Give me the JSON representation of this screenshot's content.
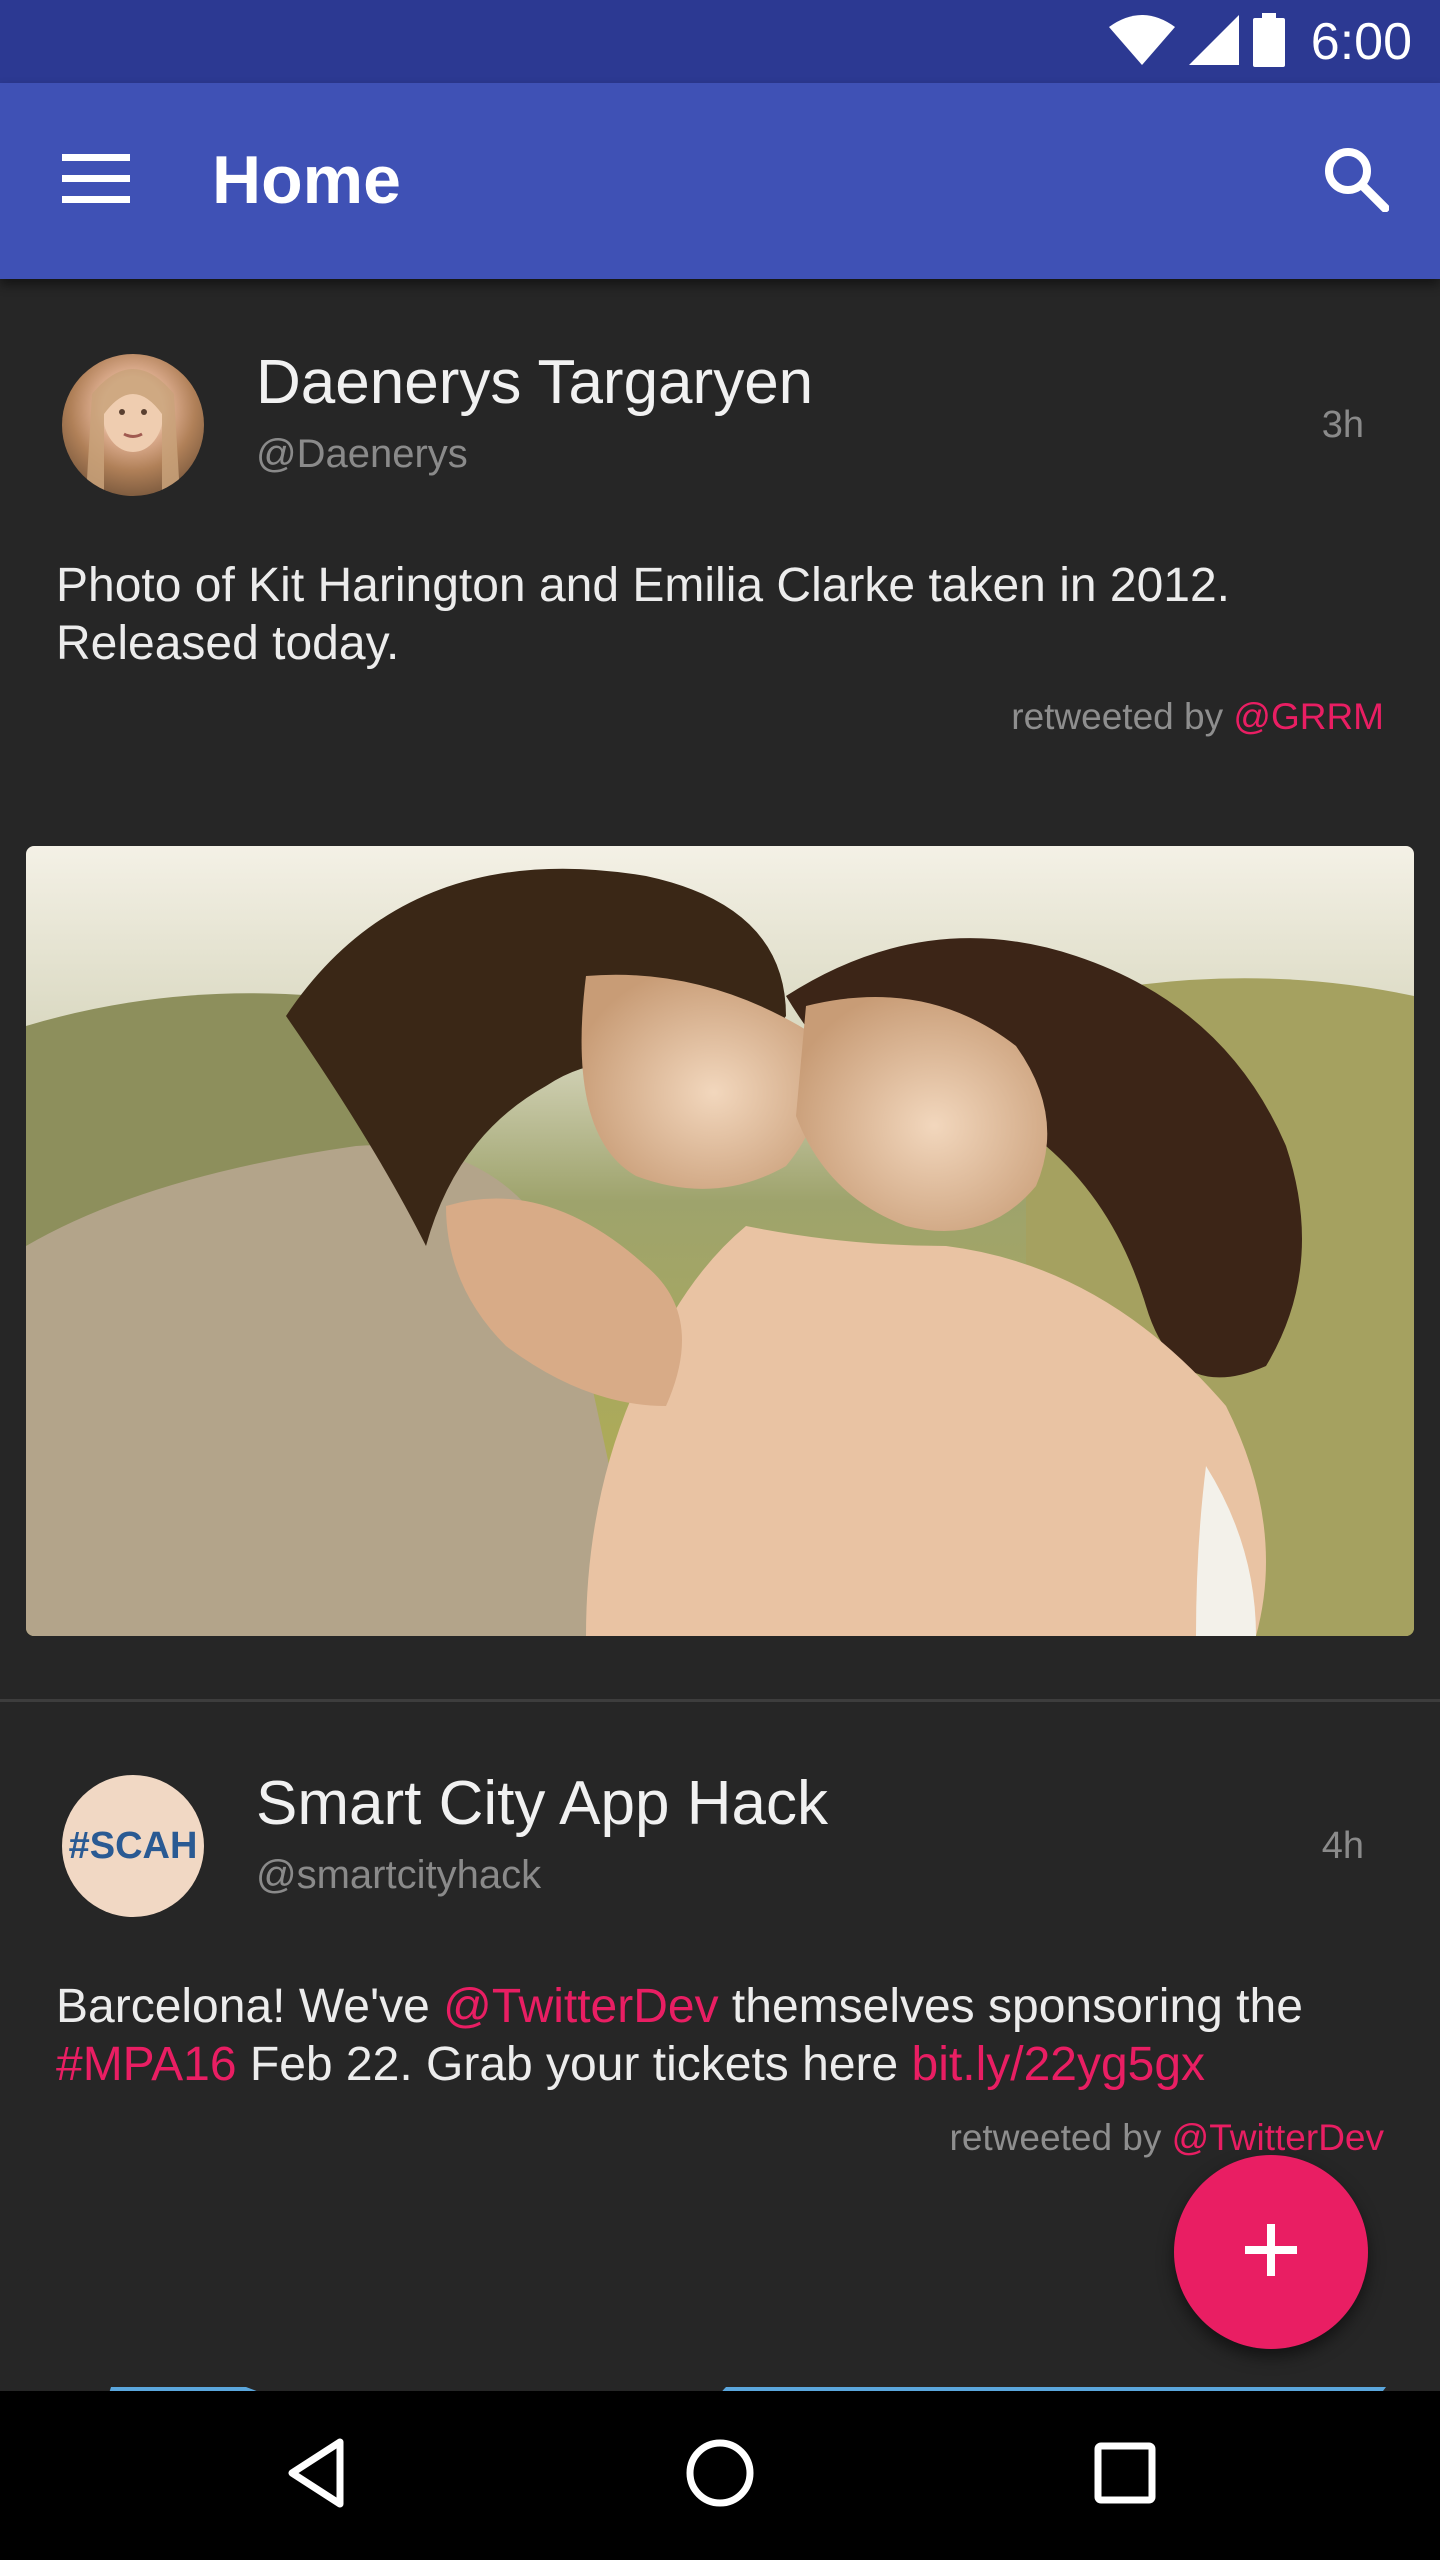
{
  "status_bar": {
    "time": "6:00",
    "icons": [
      "wifi-icon",
      "signal-icon",
      "battery-icon"
    ],
    "background": "#2c3992"
  },
  "app_bar": {
    "title": "Home",
    "menu_icon": "hamburger-menu-icon",
    "search_icon": "search-icon",
    "background": "#3f51b5"
  },
  "tweets": [
    {
      "name": "Daenerys Targaryen",
      "handle": "@Daenerys",
      "time": "3h",
      "text": "Photo of Kit Harington and Emilia Clarke taken in 2012. Released today.",
      "retweeted_prefix": "retweeted by ",
      "retweeted_by": "@GRRM",
      "has_photo": true
    },
    {
      "name": "Smart City App Hack",
      "handle": "@smartcityhack",
      "time": "4h",
      "avatar_text": "#SCAH",
      "text_parts": [
        "Barcelona! We've ",
        "@TwitterDev",
        " themselves sponsoring the ",
        "#MPA16",
        " Feb 22. Grab your tickets here ",
        "bit.ly/22yg5gx"
      ],
      "retweeted_prefix": "retweeted by ",
      "retweeted_by": "@TwitterDev",
      "has_photo": true
    }
  ],
  "fab": {
    "icon": "plus-icon",
    "color": "#e91e63"
  },
  "nav_bar": {
    "icons": [
      "back-triangle-icon",
      "home-circle-icon",
      "recents-square-icon"
    ]
  },
  "colors": {
    "accent": "#e91e63",
    "background": "#262626"
  }
}
